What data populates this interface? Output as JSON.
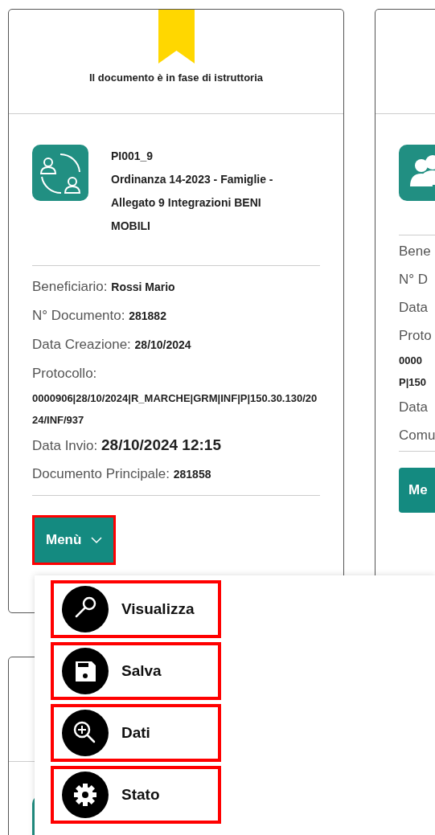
{
  "cards": [
    {
      "status": "Il documento è in fase di istruttoria",
      "code": "PI001_9",
      "title": "Ordinanza 14-2023 - Famiglie - Allegato 9 Integrazioni BENI MOBILI",
      "fields": [
        {
          "kind": "inline",
          "label": "Beneficiario:",
          "value": "Rossi Mario"
        },
        {
          "kind": "inline",
          "label": "N° Documento:",
          "value": "281882"
        },
        {
          "kind": "inline",
          "label": "Data Creazione:",
          "value": "28/10/2024"
        },
        {
          "kind": "block",
          "label": "Protocollo:",
          "value": "0000906|28/10/2024|R_MARCHE|GRM|INF|P|150.30.130/2024/INF/937"
        },
        {
          "kind": "large",
          "label": "Data Invio:",
          "value": "28/10/2024 12:15"
        },
        {
          "kind": "inline",
          "label": "Documento Principale:",
          "value": "281858"
        }
      ],
      "menu_button": {
        "label": "Menù",
        "highlighted": true
      }
    },
    {
      "fields": [
        {
          "kind": "inline",
          "label": "Bene"
        },
        {
          "kind": "inline",
          "label": "N° D"
        },
        {
          "kind": "inline",
          "label": "Data"
        },
        {
          "kind": "block",
          "label": "Proto",
          "value": "0000",
          "value2": "P|150"
        },
        {
          "kind": "inline",
          "label": "Data"
        },
        {
          "kind": "inline",
          "label": "Comu"
        }
      ],
      "menu_button": {
        "label": "Me",
        "highlighted": false
      }
    }
  ],
  "dropdown": [
    {
      "kind": "view",
      "label": "Visualizza",
      "highlighted": true
    },
    {
      "kind": "save",
      "label": "Salva",
      "highlighted": true
    },
    {
      "kind": "zoom",
      "label": "Dati",
      "highlighted": true
    },
    {
      "kind": "settings",
      "label": "Stato",
      "highlighted": true
    }
  ]
}
